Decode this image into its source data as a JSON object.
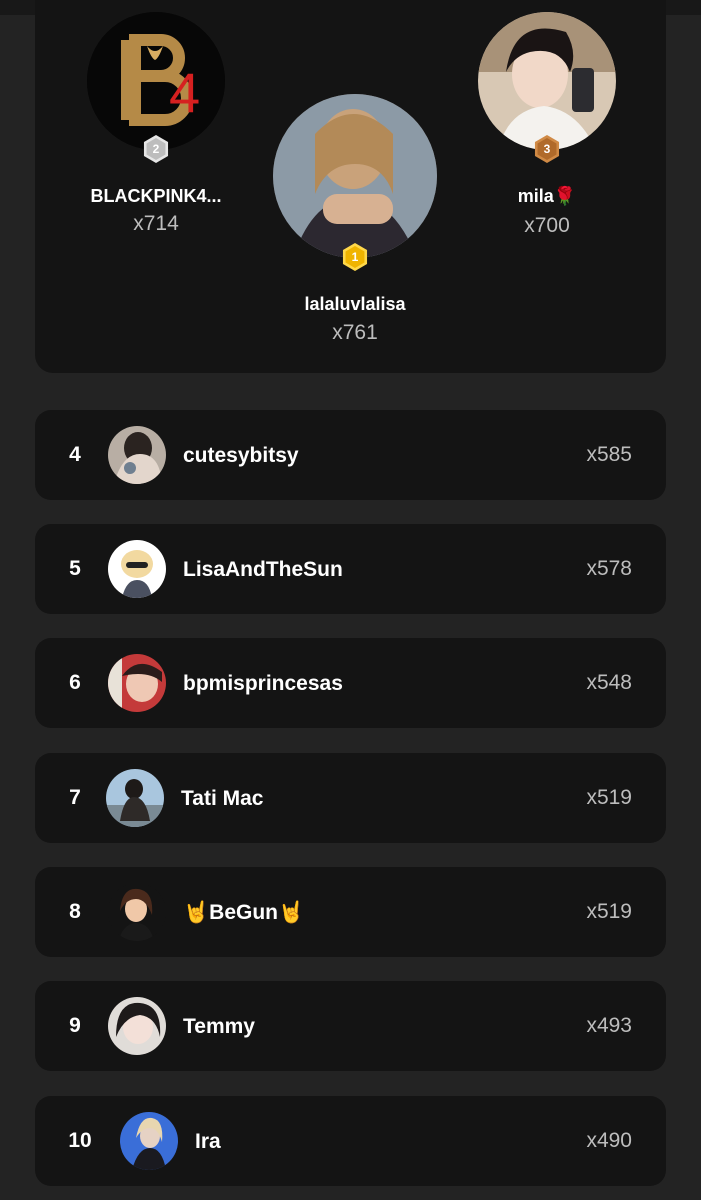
{
  "podium": [
    {
      "rank": "2",
      "name": "BLACKPINK4...",
      "count": "x714",
      "logo_text": "B",
      "logo_num": "4"
    },
    {
      "rank": "1",
      "name": "lalaluvlalisa",
      "count": "x761"
    },
    {
      "rank": "3",
      "name": "mila🌹",
      "count": "x700"
    }
  ],
  "rows": [
    {
      "rank": "4",
      "name": "cutesybitsy",
      "count": "x585"
    },
    {
      "rank": "5",
      "name": "LisaAndTheSun",
      "count": "x578"
    },
    {
      "rank": "6",
      "name": "bpmisprincesas",
      "count": "x548"
    },
    {
      "rank": "7",
      "name": "Tati Mac",
      "count": "x519"
    },
    {
      "rank": "8",
      "name": "🤘BeGun🤘",
      "count": "x519"
    },
    {
      "rank": "9",
      "name": "Temmy",
      "count": "x493"
    },
    {
      "rank": "10",
      "name": "Ira",
      "count": "x490"
    }
  ],
  "colors": {
    "gold": "#f0b400",
    "silver": "#c8c8c8",
    "bronze": "#b06a2a",
    "card": "#141414",
    "background": "#232323"
  }
}
